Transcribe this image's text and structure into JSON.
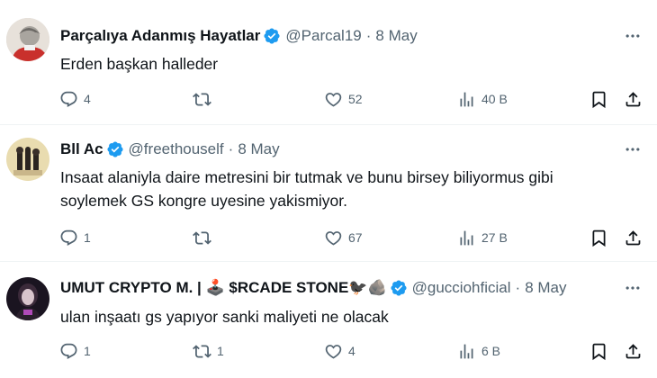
{
  "colors": {
    "text": "#0f1419",
    "secondary": "#536471",
    "verified": "#1d9bf0",
    "divider": "#eff3f4"
  },
  "tweets": [
    {
      "name": "Parçalıya Adanmış Hayatlar",
      "handle": "@Parcal19",
      "separator": "·",
      "date": "8 May",
      "text": "Erden başkan halleder",
      "replies": "4",
      "retweets": "",
      "likes": "52",
      "views": "40 B",
      "verified": true
    },
    {
      "name": "Bll Ac",
      "handle": "@freethouself",
      "separator": "·",
      "date": "8 May",
      "text": "Insaat alaniyla daire metresini bir tutmak ve bunu birsey biliyormus gibi soylemek GS kongre uyesine yakismiyor.",
      "replies": "1",
      "retweets": "",
      "likes": "67",
      "views": "27 B",
      "verified": true
    },
    {
      "name": "UMUT CRYPTO M. | 🕹️ $RCADE STONE🐦‍⬛🪨",
      "handle": "@gucciohficial",
      "separator": "·",
      "date": "8 May",
      "text": "ulan  inşaatı gs yapıyor sanki maliyeti ne olacak",
      "replies": "1",
      "retweets": "1",
      "likes": "4",
      "views": "6 B",
      "verified": true
    }
  ]
}
